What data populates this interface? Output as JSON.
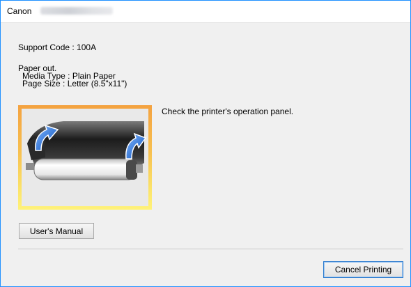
{
  "window": {
    "title_prefix": "Canon"
  },
  "dialog": {
    "support_code": "Support Code : 100A",
    "status": "Paper out.",
    "media_type": "Media Type : Plain Paper",
    "page_size": "Page Size : Letter (8.5\"x11\")",
    "instruction": "Check the printer's operation panel.",
    "illustration": "paper-roll-load-illustration"
  },
  "buttons": {
    "manual": "User's Manual",
    "cancel": "Cancel Printing"
  },
  "colors": {
    "window_border": "#1e90ff",
    "dialog_bg": "#f0f0f0",
    "frame_top": "#f4a240",
    "frame_bottom": "#fff27a",
    "arrow_blue": "#1f6fd0",
    "default_button_border": "#2b7bd0"
  }
}
